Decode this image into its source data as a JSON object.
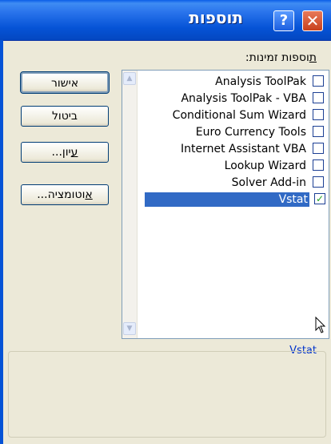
{
  "window": {
    "title": "תוספות"
  },
  "list": {
    "label_accel": "ת",
    "label_rest": "וספות זמינות:",
    "items": [
      {
        "label": "Analysis ToolPak",
        "checked": false
      },
      {
        "label": "Analysis ToolPak - VBA",
        "checked": false
      },
      {
        "label": "Conditional Sum Wizard",
        "checked": false
      },
      {
        "label": "Euro Currency Tools",
        "checked": false
      },
      {
        "label": "Internet Assistant VBA",
        "checked": false
      },
      {
        "label": "Lookup Wizard",
        "checked": false
      },
      {
        "label": "Solver Add-in",
        "checked": false
      },
      {
        "label": "Vstat",
        "checked": true,
        "selected": true
      }
    ]
  },
  "buttons": {
    "ok": "אישור",
    "cancel": "ביטול",
    "browse_pre": "",
    "browse_accel": "ע",
    "browse_rest": "יון...",
    "automation_accel": "א",
    "automation_rest": "וטומציה..."
  },
  "selected_name": "Vstat",
  "checkmark": "✓"
}
